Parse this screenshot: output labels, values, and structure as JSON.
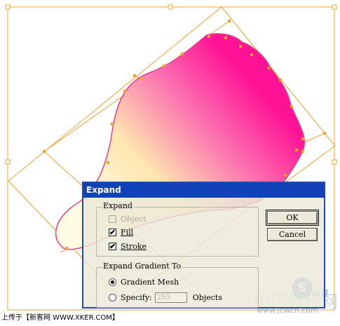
{
  "dialog": {
    "title": "Expand",
    "expand_group": {
      "legend": "Expand",
      "object": {
        "label": "Object",
        "checked": false,
        "disabled": true
      },
      "fill": {
        "label": "Fill",
        "checked": true
      },
      "stroke": {
        "label": "Stroke",
        "checked": true
      }
    },
    "gradient_group": {
      "legend": "Expand Gradient To",
      "gradient_mesh_label": "Gradient Mesh",
      "specify_label": "Specify:",
      "specify_value": "255",
      "objects_label": "Objects",
      "selected": "Gradient Mesh"
    },
    "ok_label": "OK",
    "cancel_label": "Cancel"
  },
  "watermark": {
    "caption": "上传于【新客网 WWW.XKER.COM】",
    "site_text": "www.jcwcn.com",
    "brand_text": "中国教程网",
    "logo_text": "联盟"
  },
  "colors": {
    "selection_orange": "#f5a02a",
    "petal_magenta": "#ff1f9a",
    "petal_yellow": "#fdf3c0",
    "title_blue": "#1142b8"
  }
}
